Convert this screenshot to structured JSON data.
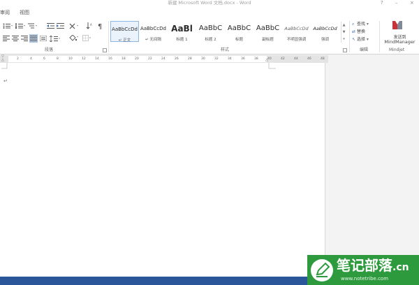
{
  "window": {
    "title": "新建 Microsoft Word 文档.docx - Word",
    "help_symbol": "?",
    "minimize_symbol": "–",
    "close_symbol": "×"
  },
  "tabs": [
    {
      "label": "审阅"
    },
    {
      "label": "视图"
    }
  ],
  "ribbon": {
    "groups": {
      "paragraph": "段落",
      "styles": "样式",
      "editing": "编辑",
      "mindjet": "Mindjet"
    },
    "styles": [
      {
        "sample": "AaBbCcDd",
        "name": "↵ 正文",
        "active": true
      },
      {
        "sample": "AaBbCcDd",
        "name": "↵ 无间隔",
        "active": false
      },
      {
        "sample": "AaBl",
        "name": "标题 1",
        "active": false
      },
      {
        "sample": "AaBbC",
        "name": "标题 2",
        "active": false
      },
      {
        "sample": "AaBbC",
        "name": "标题",
        "active": false
      },
      {
        "sample": "AaBbC",
        "name": "副标题",
        "active": false
      },
      {
        "sample": "AaBbCcDd",
        "name": "不明显强调",
        "active": false
      },
      {
        "sample": "AaBbCcDd",
        "name": "强调",
        "active": false
      }
    ],
    "editing": {
      "find": "查找",
      "replace": "替换",
      "select": "选择"
    },
    "mindjet": {
      "send_line1": "发送到",
      "send_line2": "MindManager"
    }
  },
  "ruler": {
    "ticks": [
      "2",
      "4",
      "6",
      "8",
      "10",
      "12",
      "14",
      "16",
      "18",
      "20",
      "22",
      "24",
      "26",
      "28",
      "30",
      "32",
      "34",
      "36",
      "38",
      "40",
      "42",
      "44",
      "46",
      "48"
    ]
  },
  "document": {
    "pilcrow": "↵"
  },
  "watermark": {
    "main": "笔记部落",
    "suffix": ".cn",
    "url": "www.notetribe.com"
  },
  "colors": {
    "status_bar": "#2b579a",
    "watermark_green": "#2e9a3e",
    "style_highlight": "#8eb6e3"
  }
}
